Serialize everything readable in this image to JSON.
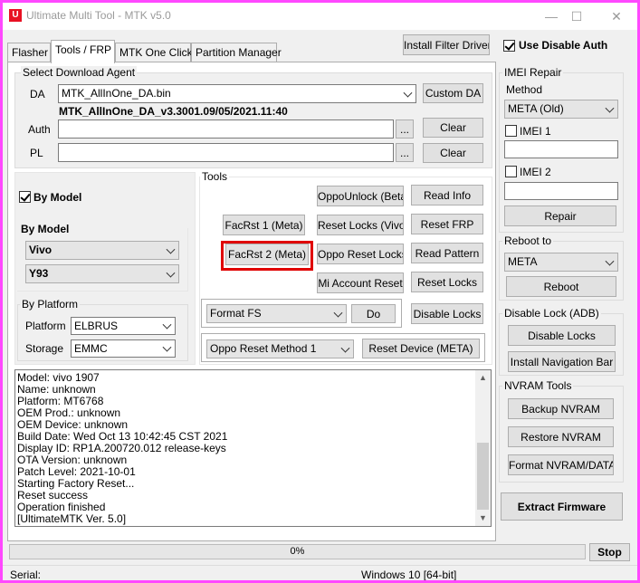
{
  "window": {
    "title": "Ultimate Multi Tool - MTK v5.0",
    "app_icon": "U",
    "controls": {
      "minimize": "—",
      "maximize": "☐",
      "close": "✕"
    }
  },
  "tabs": [
    {
      "label": "Flasher",
      "active": false
    },
    {
      "label": "Tools / FRP",
      "active": true
    },
    {
      "label": "MTK One Click",
      "active": false
    },
    {
      "label": "Partition Manager",
      "active": false
    }
  ],
  "header": {
    "install_filter_driver": "Install Filter Driver",
    "use_disable_auth": "Use Disable Auth",
    "use_disable_auth_checked": true
  },
  "download_agent": {
    "title": "Select Download Agent",
    "da_label": "DA",
    "da_value": "MTK_AllInOne_DA.bin",
    "da_info": "MTK_AllInOne_DA_v3.3001.09/05/2021.11:40",
    "custom_da": "Custom DA",
    "auth_label": "Auth",
    "pl_label": "PL",
    "browse": "...",
    "clear": "Clear"
  },
  "by_model_check": {
    "label": "By Model",
    "checked": true
  },
  "by_model_group": {
    "title": "By Model",
    "brand": "Vivo",
    "model": "Y93"
  },
  "by_platform": {
    "title": "By Platform",
    "platform_label": "Platform",
    "platform_value": "ELBRUS",
    "storage_label": "Storage",
    "storage_value": "EMMC"
  },
  "tools": {
    "title": "Tools",
    "oppo_unlock": "OppoUnlock (Beta)",
    "read_info": "Read Info",
    "facrst1": "FacRst 1 (Meta)",
    "reset_locks_vivo": "Reset Locks (Vivo)",
    "reset_frp": "Reset FRP",
    "facrst2": "FacRst 2 (Meta)",
    "oppo_reset_locks": "Oppo Reset Locks",
    "read_pattern": "Read Pattern",
    "mi_account_reset": "Mi Account Reset",
    "reset_locks": "Reset Locks",
    "format_value": "Format FS",
    "do": "Do",
    "disable_locks": "Disable Locks",
    "oppo_method_value": "Oppo Reset Method 1",
    "reset_device_meta": "Reset Device (META)"
  },
  "log": [
    "Model: vivo 1907",
    "Name: unknown",
    "Platform: MT6768",
    "OEM Prod.: unknown",
    "OEM Device: unknown",
    "Build Date: Wed Oct 13 10:42:45 CST 2021",
    "Display ID: RP1A.200720.012 release-keys",
    "OTA Version: unknown",
    "Patch Level: 2021-10-01",
    "Starting Factory Reset...",
    "Reset success",
    "Operation finished",
    "[UltimateMTK Ver. 5.0]"
  ],
  "imei_repair": {
    "title": "IMEI Repair",
    "method_label": "Method",
    "method_value": "META (Old)",
    "imei1": "IMEI 1",
    "imei2": "IMEI 2",
    "repair": "Repair"
  },
  "reboot_to": {
    "title": "Reboot to",
    "mode_value": "META",
    "reboot": "Reboot"
  },
  "disable_lock_adb": {
    "title": "Disable Lock (ADB)",
    "disable_locks": "Disable Locks",
    "install_nav_bar": "Install Navigation Bar"
  },
  "nvram_tools": {
    "title": "NVRAM Tools",
    "backup": "Backup NVRAM",
    "restore": "Restore NVRAM",
    "format": "Format NVRAM/DATA"
  },
  "extract_firmware": "Extract Firmware",
  "progress": {
    "value": 0,
    "text": "0%"
  },
  "stop": "Stop",
  "status": {
    "serial_label": "Serial:",
    "os": "Windows 10 [64-bit]"
  },
  "colors": {
    "highlight": "#e00000",
    "window_border": "#ff48ff",
    "close_icon": "#e81123"
  }
}
